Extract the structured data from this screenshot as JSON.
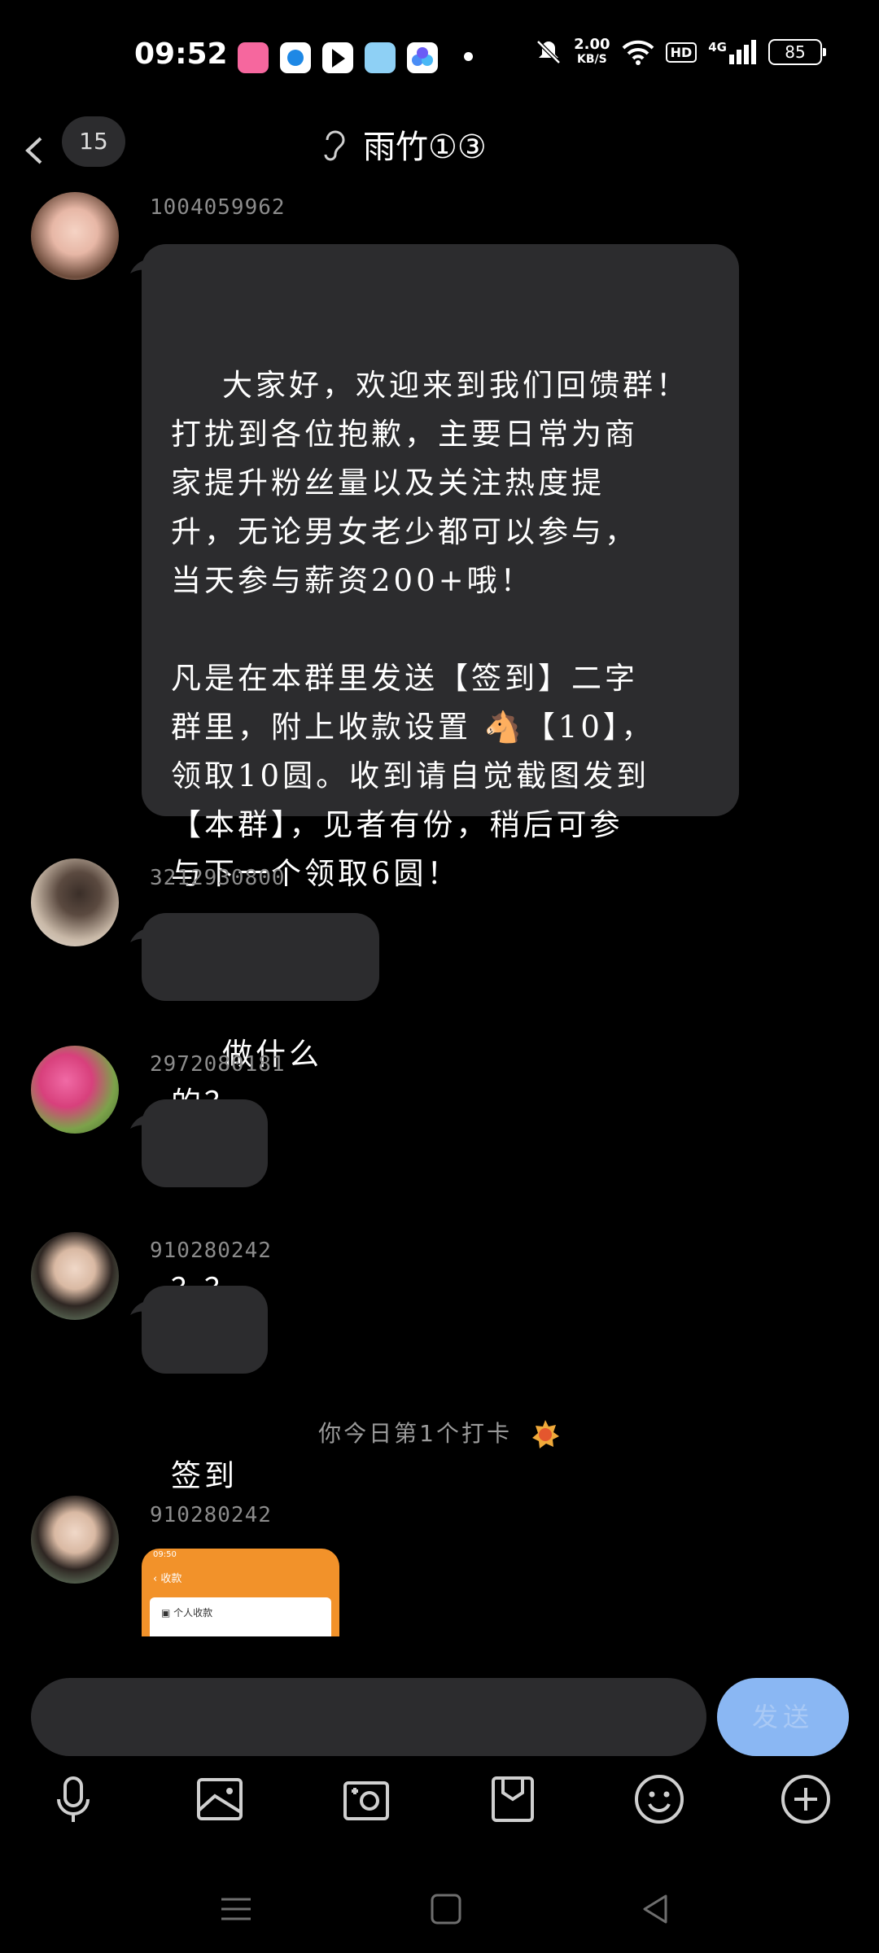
{
  "status_bar": {
    "time": "09:52",
    "speed_value": "2.00",
    "speed_unit": "KB/S",
    "hd_label": "HD",
    "network_label": "4G",
    "battery": "85"
  },
  "header": {
    "unread_count": "15",
    "title": "雨竹①③"
  },
  "messages": [
    {
      "sender": "1004059962",
      "text": "大家好，欢迎来到我们回馈群！\n打扰到各位抱歉，主要日常为商\n家提升粉丝量以及关注热度提\n升，无论男女老少都可以参与，\n当天参与薪资200+哦！\n\n凡是在本群里发送【签到】二字\n群里，附上收款设置 🐴【10】，\n领取10圆。收到请自觉截图发到\n【本群】，见者有份，稍后可参\n与下一个领取6圆！"
    },
    {
      "sender": "3212930800",
      "text": "做什么的？"
    },
    {
      "sender": "2972080181",
      "text": "？？"
    },
    {
      "sender": "910280242",
      "text": "签到"
    },
    {
      "sender": "910280242",
      "image": {
        "status_time": "09:50",
        "nav_title": "收款",
        "row_label": "个人收款"
      }
    }
  ],
  "system_notice": "你今日第1个打卡",
  "composer": {
    "send_label": "发送"
  },
  "toolbar_icons": [
    "microphone-icon",
    "image-icon",
    "camera-icon",
    "file-icon",
    "emoji-icon",
    "plus-icon"
  ],
  "colors": {
    "background": "#000000",
    "bubble": "#2c2c2e",
    "send_button": "#8ab7f3"
  }
}
